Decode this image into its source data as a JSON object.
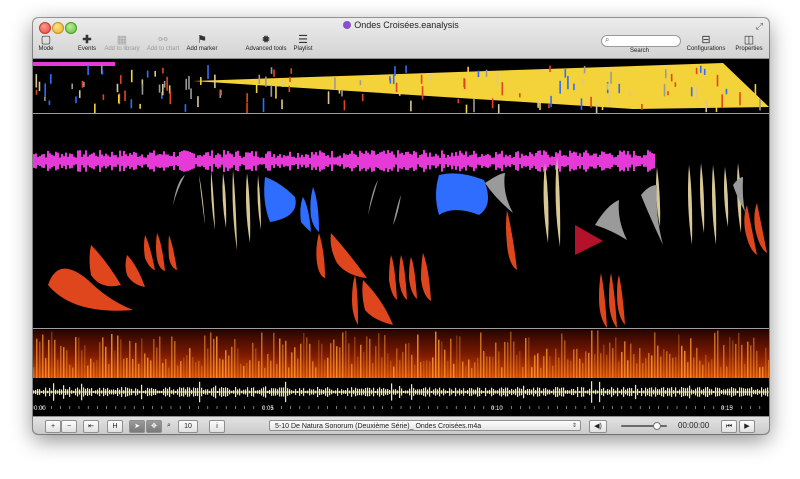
{
  "window": {
    "title": "Ondes Croisées.eanalysis"
  },
  "toolbar": {
    "mode": "Mode",
    "events": "Events",
    "add_to_library": "Add to library",
    "add_to_chart": "Add to chart",
    "add_marker": "Add marker",
    "advanced_tools": "Advanced tools",
    "playlist": "Playlist",
    "search_label": "Search",
    "search_placeholder": "",
    "configurations": "Configurations",
    "properties": "Properties"
  },
  "icons": {
    "mode": "square-icon",
    "events": "plus-icon",
    "library": "grid-icon",
    "chart": "chart-icon",
    "marker": "flag-icon",
    "advanced": "gear-icon",
    "playlist": "list-icon",
    "search": "magnifier-icon",
    "configurations": "config-icon",
    "properties": "sidebar-icon"
  },
  "timeline": {
    "ticks": [
      "0:00",
      "0:05",
      "0:10",
      "0:15"
    ]
  },
  "bottombar": {
    "plus": "+",
    "minus": "−",
    "rewind": "⇤",
    "h": "H",
    "zoom_value": "10",
    "info": "i",
    "file": "5-10 De Natura Sonorum (Deuxième Série)_ Ondes Croisées.m4a",
    "time": "00:00:00",
    "prev": "⏮",
    "play": "▶"
  },
  "colors": {
    "magenta": "#e63ad8",
    "yellow": "#f4d33a",
    "orange": "#e0461e",
    "blue": "#2f6dff",
    "beige": "#d9c894",
    "grey": "#9a9a9a",
    "red": "#b3122a"
  }
}
